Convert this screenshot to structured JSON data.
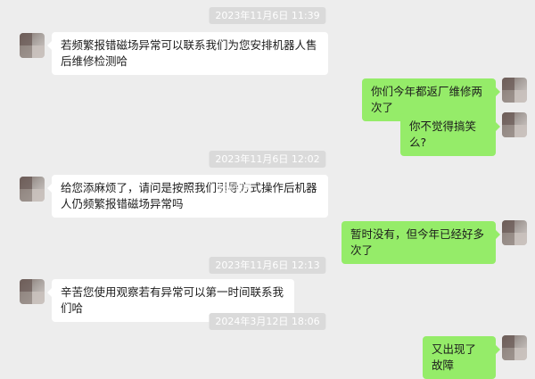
{
  "chat": {
    "timestamps": [
      "2023年11月6日 11:39",
      "2023年11月6日 12:02",
      "2023年11月6日 12:13",
      "2024年3月12日 18:06"
    ],
    "messages": [
      {
        "side": "in",
        "text": "若频繁报错磁场异常可以联系我们为您安排机器人售后维修检测哈"
      },
      {
        "side": "out",
        "text": "你们今年都返厂维修两次了"
      },
      {
        "side": "out",
        "text": "你不觉得搞笑么?"
      },
      {
        "side": "in",
        "text": "给您添麻烦了，请问是按照我们引导方式操作后机器人仍频繁报错磁场异常吗"
      },
      {
        "side": "out",
        "text": "暂时没有，但今年已经好多次了"
      },
      {
        "side": "in",
        "text": "辛苦您使用观察若有异常可以第一时间联系我们哈"
      },
      {
        "side": "out",
        "text": "又出现了故障"
      }
    ],
    "watermark": "快科技"
  },
  "colors": {
    "background": "#ededed",
    "incoming_bubble": "#ffffff",
    "outgoing_bubble": "#95ec69",
    "timestamp_bg": "#dadada"
  }
}
